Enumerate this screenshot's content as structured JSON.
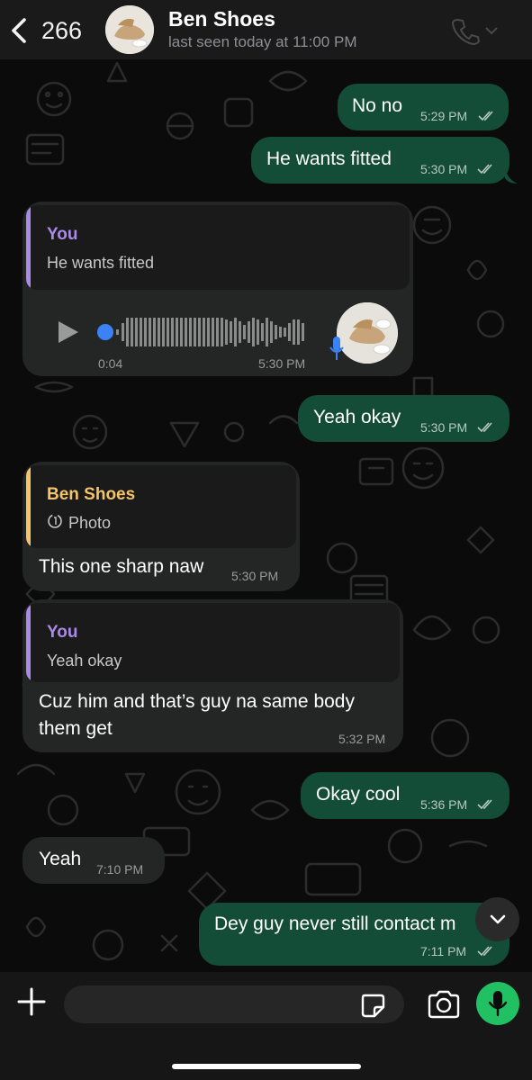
{
  "header": {
    "back_count": "266",
    "contact_name": "Ben Shoes",
    "status": "last seen today at 11:00 PM",
    "icons": [
      "chevron-left-icon",
      "phone-icon",
      "chevron-down-icon"
    ]
  },
  "messages": [
    {
      "direction": "out",
      "text": "No no",
      "time": "5:29 PM",
      "read": true
    },
    {
      "direction": "out",
      "text": "He wants fitted",
      "time": "5:30 PM",
      "read": true
    },
    {
      "direction": "in",
      "type": "voice",
      "quote": {
        "author": "You",
        "text": "He wants fitted"
      },
      "duration": "0:04",
      "time": "5:30 PM"
    },
    {
      "direction": "out",
      "text": "Yeah okay",
      "time": "5:30 PM",
      "read": true
    },
    {
      "direction": "in",
      "quote": {
        "author": "Ben Shoes",
        "text": "Photo"
      },
      "text": "This one sharp naw",
      "time": "5:30 PM"
    },
    {
      "direction": "in",
      "quote": {
        "author": "You",
        "text": "Yeah okay"
      },
      "text": "Cuz him and that’s guy na same body them get",
      "time": "5:32 PM"
    },
    {
      "direction": "out",
      "text": "Okay cool",
      "time": "5:36 PM",
      "read": true
    },
    {
      "direction": "in",
      "text": "Yeah",
      "time": "7:10 PM"
    },
    {
      "direction": "out",
      "text": "Dey guy never still contact m",
      "time": "7:11 PM",
      "read": true
    }
  ],
  "composer": {
    "placeholder": "",
    "icons": [
      "plus-icon",
      "sticker-icon",
      "camera-icon",
      "microphone-icon"
    ]
  },
  "colors": {
    "outgoing_bubble": "#144d37",
    "incoming_bubble": "#242626",
    "quote_you": "#a98ae8",
    "quote_contact": "#f5c46a",
    "mic_button": "#21c063",
    "voice_mic": "#3b82f6"
  }
}
